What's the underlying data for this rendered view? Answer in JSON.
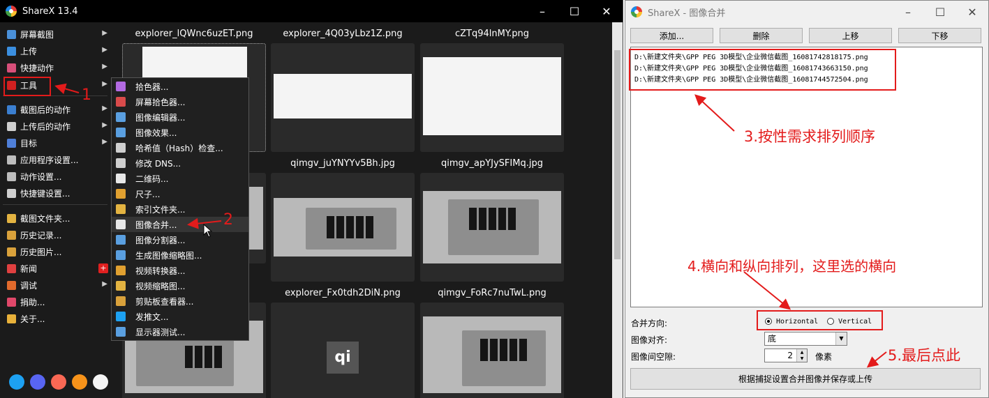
{
  "win1": {
    "title": "ShareX 13.4",
    "menu": [
      {
        "label": "屏幕截图",
        "icon": "screen-capture-icon",
        "color": "#4a90d9",
        "arrow": true
      },
      {
        "label": "上传",
        "icon": "upload-arrow-icon",
        "color": "#3b8fe0",
        "arrow": true
      },
      {
        "label": "快捷动作",
        "icon": "dots-grid-icon",
        "color": "#d84f7a",
        "arrow": true
      },
      {
        "label": "工具",
        "icon": "tools-icon",
        "color": "#d02020",
        "arrow": true
      },
      {
        "label": "截图后的动作",
        "icon": "after-capture-icon",
        "color": "#3b7fd0",
        "arrow": true
      },
      {
        "label": "上传后的动作",
        "icon": "cloud-icon",
        "color": "#cfcfcf",
        "arrow": true
      },
      {
        "label": "目标",
        "icon": "destination-icon",
        "color": "#4f7fd8",
        "arrow": true
      },
      {
        "label": "应用程序设置...",
        "icon": "wrench-icon",
        "color": "#bdbdbd",
        "arrow": false
      },
      {
        "label": "动作设置...",
        "icon": "gear-icon",
        "color": "#bdbdbd",
        "arrow": false
      },
      {
        "label": "快捷键设置...",
        "icon": "keyboard-icon",
        "color": "#cfcfcf",
        "arrow": false
      },
      {
        "label": "截图文件夹...",
        "icon": "folder-icon",
        "color": "#e3b341",
        "arrow": false
      },
      {
        "label": "历史记录...",
        "icon": "history-icon",
        "color": "#d9a13b",
        "arrow": false
      },
      {
        "label": "历史图片...",
        "icon": "image-history-icon",
        "color": "#d9a13b",
        "arrow": false
      },
      {
        "label": "新闻",
        "icon": "megaphone-icon",
        "color": "#e04040",
        "arrow": false
      },
      {
        "label": "调试",
        "icon": "cone-icon",
        "color": "#e26a2c",
        "arrow": true
      },
      {
        "label": "捐助...",
        "icon": "heart-icon",
        "color": "#e0486a",
        "arrow": false
      },
      {
        "label": "关于...",
        "icon": "crown-icon",
        "color": "#e8b13a",
        "arrow": false
      }
    ],
    "submenu": [
      {
        "label": "拾色器...",
        "icon": "color-wheel-icon",
        "color": "#b36ae2"
      },
      {
        "label": "屏幕拾色器...",
        "icon": "eyedropper-icon",
        "color": "#d94b4b"
      },
      {
        "label": "图像编辑器...",
        "icon": "image-editor-icon",
        "color": "#5a9fe0"
      },
      {
        "label": "图像效果...",
        "icon": "image-effects-icon",
        "color": "#5a9fe0"
      },
      {
        "label": "哈希值（Hash）检查...",
        "icon": "hash-check-icon",
        "color": "#cfcfcf"
      },
      {
        "label": "修改 DNS...",
        "icon": "dns-icon",
        "color": "#cfcfcf"
      },
      {
        "label": "二维码...",
        "icon": "qr-code-icon",
        "color": "#e8e8e8"
      },
      {
        "label": "尺子...",
        "icon": "ruler-icon",
        "color": "#e0a030"
      },
      {
        "label": "索引文件夹...",
        "icon": "index-folder-icon",
        "color": "#e3b341"
      },
      {
        "label": "图像合并...",
        "icon": "image-combiner-icon",
        "color": "#e8e8e8"
      },
      {
        "label": "图像分割器...",
        "icon": "image-splitter-icon",
        "color": "#5a9fe0"
      },
      {
        "label": "生成图像缩略图...",
        "icon": "thumbnail-icon",
        "color": "#5a9fe0"
      },
      {
        "label": "视频转换器...",
        "icon": "video-converter-icon",
        "color": "#e0a030"
      },
      {
        "label": "视频缩略图...",
        "icon": "video-thumbnail-icon",
        "color": "#e3b341"
      },
      {
        "label": "剪贴板查看器...",
        "icon": "clipboard-icon",
        "color": "#d9a13b"
      },
      {
        "label": "发推文...",
        "icon": "twitter-icon",
        "color": "#1da1f2"
      },
      {
        "label": "显示器测试...",
        "icon": "monitor-icon",
        "color": "#5a9fe0"
      }
    ],
    "thumbnails": [
      {
        "name": "explorer_lQWnc6uzET.png"
      },
      {
        "name": "explorer_4Q03yLbz1Z.png"
      },
      {
        "name": "cZTq94lnMY.png"
      },
      {
        "name": "qimgv_juYNYYv5Bh.jpg"
      },
      {
        "name": "qimgv_apYJySFIMq.jpg"
      },
      {
        "name": "explorer_Fx0tdh2DiN.png"
      },
      {
        "name": "qimgv_FoRc7nuTwL.png"
      }
    ],
    "news_badge": "+",
    "placeholder_logo": "qi"
  },
  "win2": {
    "title": "ShareX - 图像合并",
    "buttons": {
      "add": "添加...",
      "remove": "删除",
      "up": "上移",
      "down": "下移"
    },
    "files": [
      "D:\\新建文件夹\\GPP PEG 3D模型\\企业微信截图_16081742818175.png",
      "D:\\新建文件夹\\GPP PEG 3D模型\\企业微信截图_16081743663150.png",
      "D:\\新建文件夹\\GPP PEG 3D模型\\企业微信截图_16081744572504.png"
    ],
    "orientation_label": "合并方向:",
    "horizontal": "Horizontal",
    "vertical": "Vertical",
    "selected_orientation": "Horizontal",
    "align_label": "图像对齐:",
    "align_value": "底",
    "spacing_label": "图像间空隙:",
    "spacing_value": "2",
    "spacing_unit": "像素",
    "combine_button": "根据捕捉设置合并图像并保存或上传"
  },
  "annotations": {
    "n1": "1",
    "n2": "2",
    "n3": "3.按性需求排列顺序",
    "n4": "4.横向和纵向排列，这里选的横向",
    "n5": "5.最后点此"
  },
  "colors": {
    "annotation": "#e31b1b",
    "dark_bg": "#1b1b1b",
    "dialog_bg": "#f0f0f0"
  }
}
